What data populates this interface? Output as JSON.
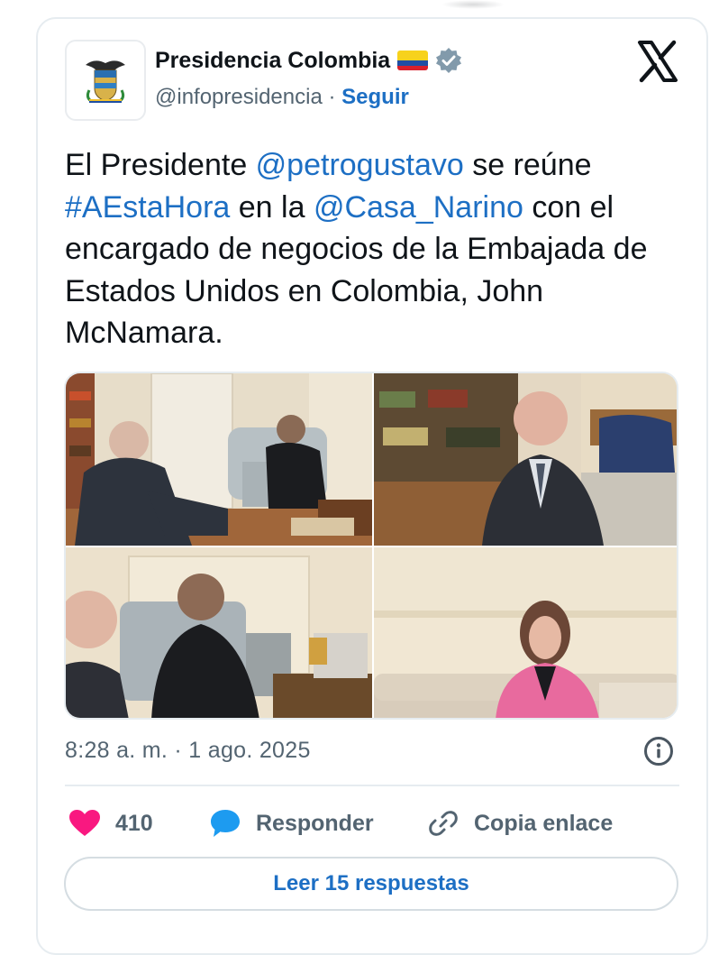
{
  "author": {
    "display_name": "Presidencia Colombia",
    "handle": "@infopresidencia",
    "separator": "·",
    "follow_label": "Seguir"
  },
  "tweet": {
    "text_segments": [
      {
        "text": "El Presidente ",
        "link": false
      },
      {
        "text": "@petrogustavo",
        "link": true
      },
      {
        "text": " se reúne ",
        "link": false
      },
      {
        "text": "#AEstaHora",
        "link": true
      },
      {
        "text": " en la ",
        "link": false
      },
      {
        "text": "@Casa_Narino",
        "link": true
      },
      {
        "text": " con el encargado de negocios de la Embajada de Estados Unidos en Colombia, John McNamara.",
        "link": false
      }
    ],
    "timestamp": "8:28 a. m. · 1 ago. 2025"
  },
  "actions": {
    "like_count": "410",
    "reply_label": "Responder",
    "copy_label": "Copia enlace",
    "read_replies_label": "Leer 15 respuestas"
  },
  "icons": {
    "logo": "x-logo-icon",
    "verified": "verified-badge-icon",
    "flag": "colombia-flag-icon",
    "info": "info-icon",
    "like": "heart-icon",
    "reply": "speech-bubble-icon",
    "copy": "link-icon"
  },
  "colors": {
    "link": "#1d6fc4",
    "secondary_text": "#536471",
    "heart": "#f91880",
    "reply_icon": "#1d9bf0",
    "border": "#e6ecf0"
  }
}
